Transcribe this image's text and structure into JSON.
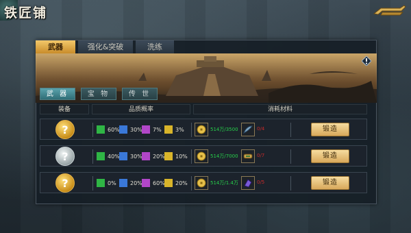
{
  "header": {
    "title": "铁匠铺"
  },
  "top_tabs": [
    {
      "label": "武器",
      "active": true
    },
    {
      "label": "强化&突破",
      "active": false
    },
    {
      "label": "洗练",
      "active": false
    }
  ],
  "sub_tabs": [
    {
      "label": "武 器",
      "active": true
    },
    {
      "label": "宝 物",
      "active": false
    },
    {
      "label": "传 世",
      "active": false
    }
  ],
  "columns": {
    "equip": "装备",
    "quality": "品质概率",
    "materials": "消耗材料"
  },
  "rows": [
    {
      "icon": "gold-mystery-equipment-icon",
      "icon_glyph": "?",
      "quality": [
        "60%",
        "30%",
        "7%",
        "3%"
      ],
      "coin_text": "514万/3500",
      "item_text": "0/4",
      "item_icon": "feather-material-icon",
      "forge_label": "锻造"
    },
    {
      "icon": "silver-mystery-equipment-icon",
      "icon_glyph": "?",
      "quality": [
        "40%",
        "30%",
        "20%",
        "10%"
      ],
      "coin_text": "514万/7000",
      "item_text": "0/7",
      "item_icon": "scroll-material-icon",
      "forge_label": "锻造"
    },
    {
      "icon": "gold-mystery-equipment-icon",
      "icon_glyph": "?",
      "quality": [
        "0%",
        "20%",
        "60%",
        "20%"
      ],
      "coin_text": "514万/1.4万",
      "item_text": "0/5",
      "item_icon": "gem-material-icon",
      "forge_label": "锻造"
    }
  ],
  "colors": {
    "green": "#2fb545",
    "blue": "#3a78d8",
    "purple": "#b146c8",
    "yellow": "#d8b42a",
    "enough": "#27d24b",
    "insufficient": "#c82a2a"
  }
}
